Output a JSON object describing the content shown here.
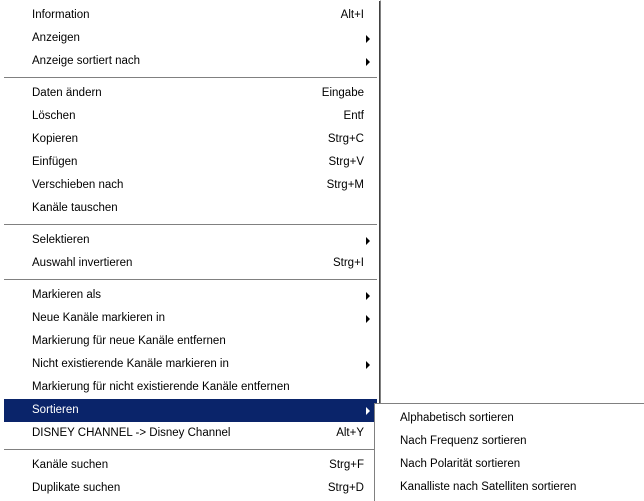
{
  "context_menu": {
    "items": [
      {
        "label": "Information",
        "shortcut": "Alt+I"
      },
      {
        "label": "Anzeigen",
        "submenu": true
      },
      {
        "label": "Anzeige sortiert nach",
        "submenu": true
      },
      {
        "label": "Daten ändern",
        "shortcut": "Eingabe"
      },
      {
        "label": "Löschen",
        "shortcut": "Entf"
      },
      {
        "label": "Kopieren",
        "shortcut": "Strg+C"
      },
      {
        "label": "Einfügen",
        "shortcut": "Strg+V"
      },
      {
        "label": "Verschieben nach",
        "shortcut": "Strg+M"
      },
      {
        "label": "Kanäle tauschen"
      },
      {
        "label": "Selektieren",
        "submenu": true
      },
      {
        "label": "Auswahl invertieren",
        "shortcut": "Strg+I"
      },
      {
        "label": "Markieren als",
        "submenu": true
      },
      {
        "label": "Neue Kanäle markieren in",
        "submenu": true
      },
      {
        "label": "Markierung für neue Kanäle entfernen"
      },
      {
        "label": "Nicht existierende Kanäle markieren in",
        "submenu": true
      },
      {
        "label": "Markierung für nicht existierende Kanäle entfernen"
      },
      {
        "label": "Sortieren",
        "submenu": true,
        "highlighted": true
      },
      {
        "label": "DISNEY CHANNEL -> Disney Channel",
        "shortcut": "Alt+Y"
      },
      {
        "label": "Kanäle suchen",
        "shortcut": "Strg+F"
      },
      {
        "label": "Duplikate suchen",
        "shortcut": "Strg+D"
      }
    ]
  },
  "sort_submenu": {
    "items": [
      {
        "label": "Alphabetisch sortieren"
      },
      {
        "label": "Nach Frequenz sortieren"
      },
      {
        "label": "Nach Polarität sortieren"
      },
      {
        "label": "Kanalliste nach Satelliten sortieren"
      }
    ]
  },
  "colors": {
    "highlight_background": "#0a246a",
    "highlight_text": "#ffffff",
    "menu_background": "#ffffff",
    "separator": "#808080"
  }
}
